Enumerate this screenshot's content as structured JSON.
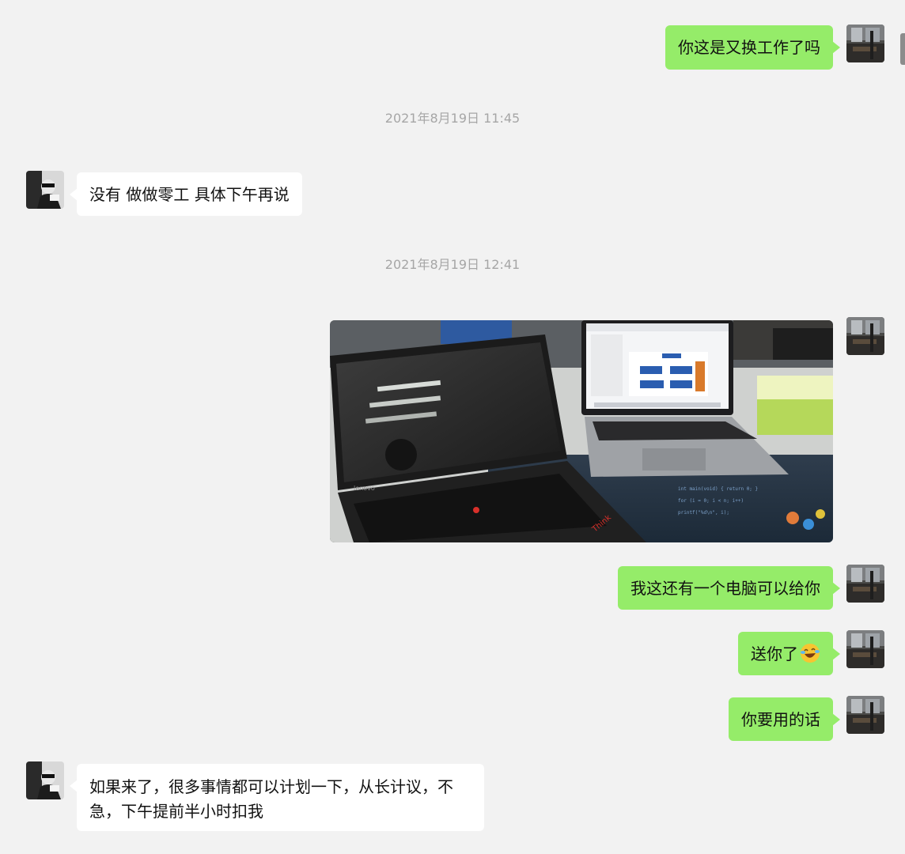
{
  "messages": [
    {
      "from": "me",
      "text": "你这是又换工作了吗"
    },
    {
      "timestamp": "2021年8月19日 11:45"
    },
    {
      "from": "them",
      "text": "没有 做做零工 具体下午再说"
    },
    {
      "timestamp": "2021年8月19日 12:41"
    },
    {
      "from": "me",
      "type": "image"
    },
    {
      "from": "me",
      "text": "我这还有一个电脑可以给你"
    },
    {
      "from": "me",
      "text": "送你了",
      "emoji": "laughing-tears-emoji"
    },
    {
      "from": "me",
      "text": "你要用的话"
    },
    {
      "from": "them",
      "text": "如果来了，很多事情都可以计划一下，从长计议，不急，下午提前半小时扣我"
    }
  ],
  "timestamps": {
    "t1": "2021年8月19日 11:45",
    "t2": "2021年8月19日 12:41"
  },
  "bubbles": {
    "m1": "你这是又换工作了吗",
    "m2": "没有 做做零工 具体下午再说",
    "m3": "我这还有一个电脑可以给你",
    "m4": "送你了",
    "m5": "你要用的话",
    "m6": "如果来了，很多事情都可以计划一下，从长计议，不急，下午提前半小时扣我"
  },
  "colors": {
    "background": "#f2f2f2",
    "my_bubble": "#95ec69",
    "their_bubble": "#ffffff",
    "timestamp_text": "#a6a6a6"
  }
}
